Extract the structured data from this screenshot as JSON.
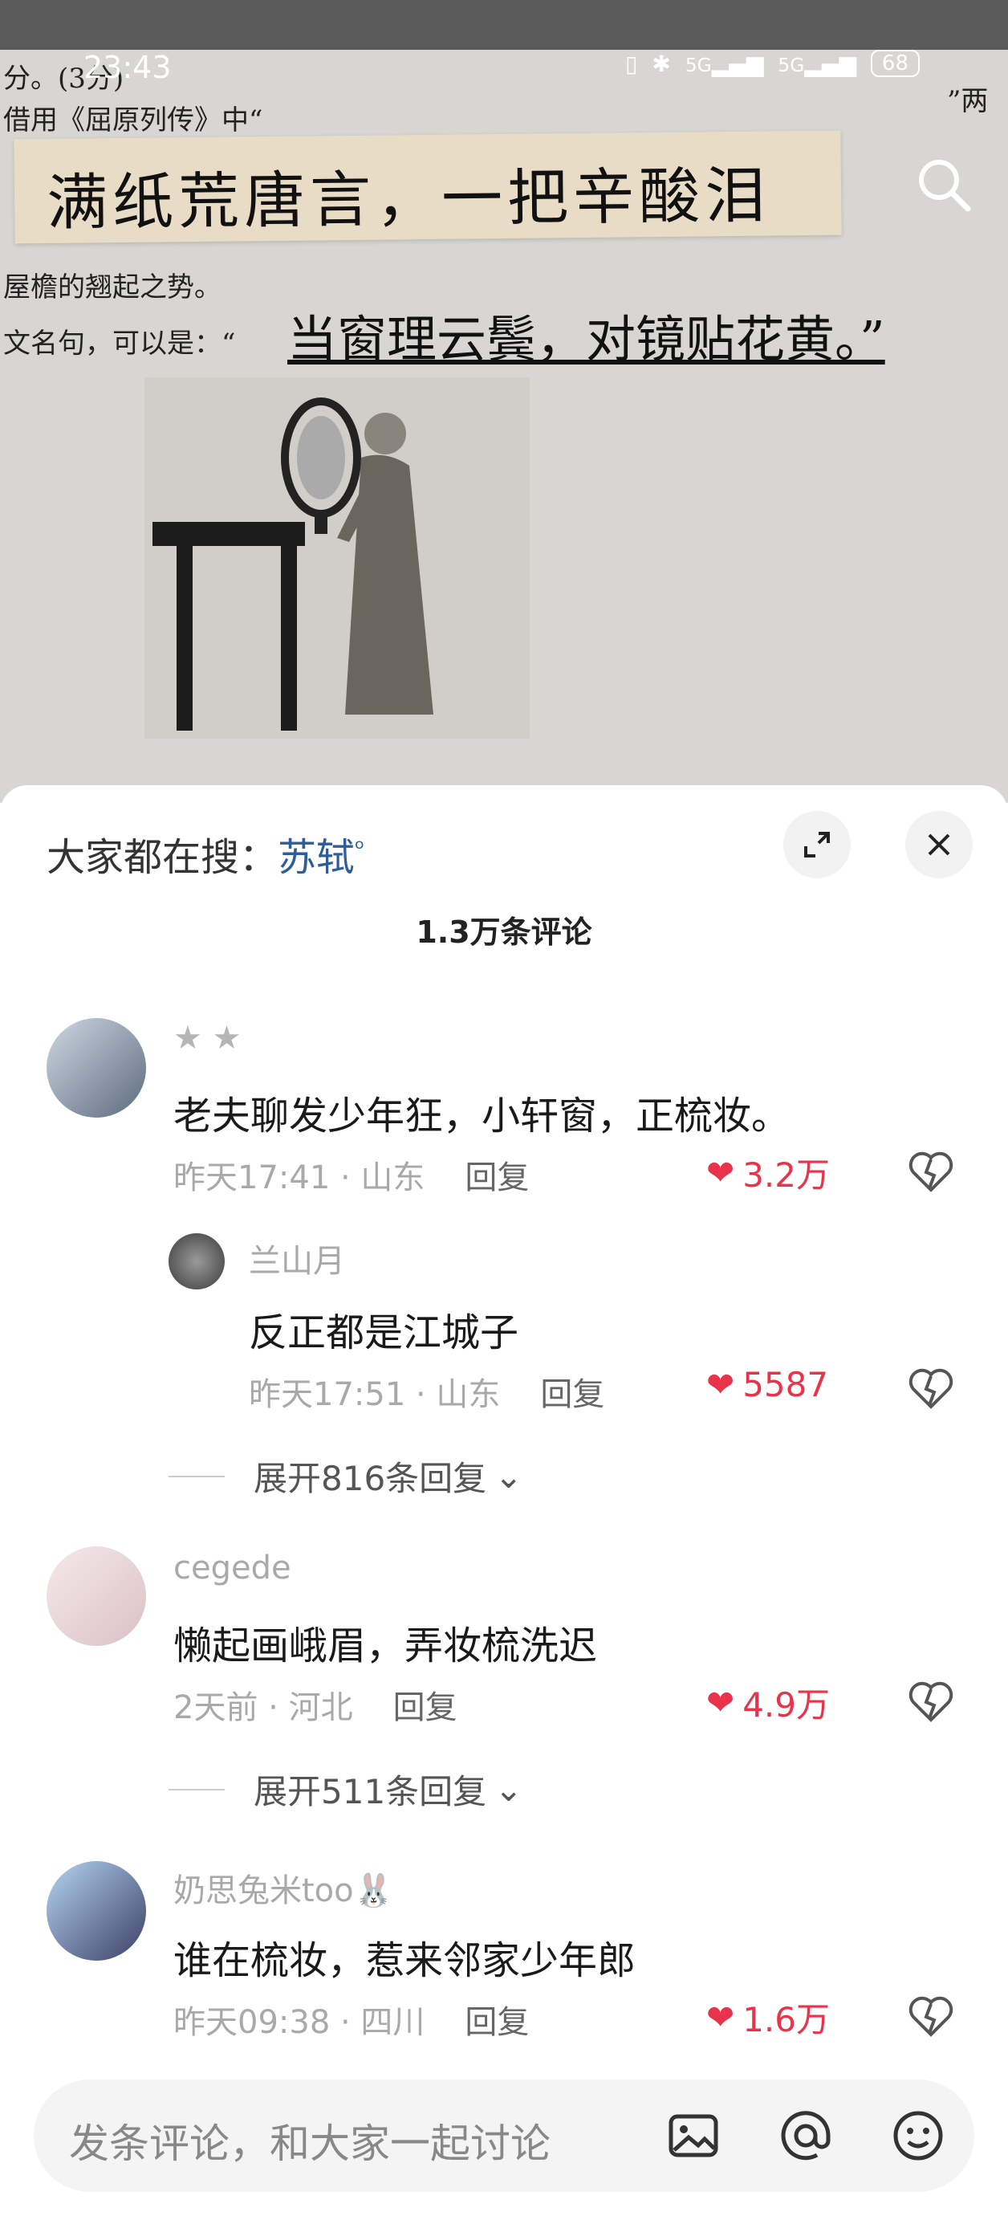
{
  "status_bar": {
    "time": "23:43",
    "signal1": "5G",
    "signal2": "5G",
    "battery": "68"
  },
  "video": {
    "sticker_text": "满纸荒唐言，一把辛酸泪",
    "paper_lines": [
      "分。(3分)",
      "借用《屈原列传》中“",
      "”两",
      "屋檐的翘起之势。",
      "文名句，可以是：“"
    ],
    "handwritten": "当窗理云鬓，对镜贴花黄。”"
  },
  "sheet": {
    "hot_search_label": "大家都在搜：",
    "hot_search_keyword": "苏轼",
    "comment_count": "1.3万条评论",
    "comments": [
      {
        "user": "★ ★",
        "text": "老夫聊发少年狂，小轩窗，正梳妆。",
        "time": "昨天17:41 · 山东",
        "reply": "回复",
        "likes": "3.2万"
      },
      {
        "user": "兰山月",
        "text": "反正都是江城子",
        "time": "昨天17:51 · 山东",
        "reply": "回复",
        "likes": "5587"
      },
      {
        "user": "cegede",
        "text": "懒起画峨眉，弄妆梳洗迟",
        "time": "2天前 · 河北",
        "reply": "回复",
        "likes": "4.9万"
      },
      {
        "user": "奶思兔米too🐰",
        "text": "谁在梳妆，惹来邻家少年郎",
        "time": "昨天09:38 · 四川",
        "reply": "回复",
        "likes": "1.6万"
      }
    ],
    "expand_replies": [
      "展开816条回复",
      "展开511条回复"
    ],
    "input_placeholder": "发条评论，和大家一起讨论"
  },
  "colors": {
    "like_red": "#e8334a",
    "keyword_blue": "#2d5d9a"
  }
}
